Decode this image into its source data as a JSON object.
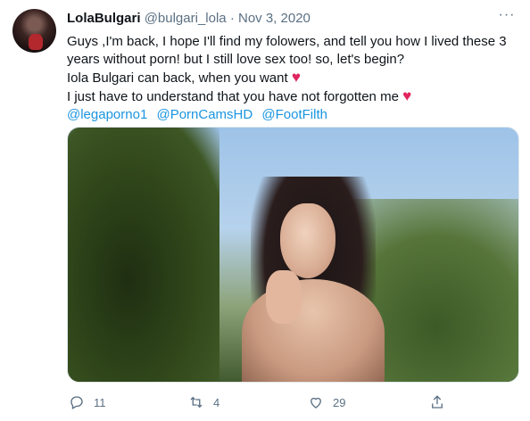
{
  "tweet": {
    "display_name": "LolaBulgari",
    "handle": "@bulgari_lola",
    "separator": "·",
    "date": "Nov 3, 2020",
    "more_label": "···",
    "body_lines": [
      "Guys ,I'm back, I hope I'll find my folowers, and tell you how I lived these 3",
      "years without porn! but I still love sex too! so, let's begin?",
      " Iola Bulgari can back, when you want",
      "I just have to understand that you have not forgotten me"
    ],
    "heart_emoji": "♥",
    "mentions": [
      "@legaporno1",
      "@PornCamsHD",
      "@FootFilth"
    ]
  },
  "actions": {
    "reply_count": "11",
    "retweet_count": "4",
    "like_count": "29",
    "reply_icon": "reply-icon",
    "retweet_icon": "retweet-icon",
    "like_icon": "heart-outline-icon",
    "share_icon": "share-icon"
  },
  "colors": {
    "link": "#1b95e0",
    "meta": "#5b7083",
    "heart": "#e0245e"
  }
}
